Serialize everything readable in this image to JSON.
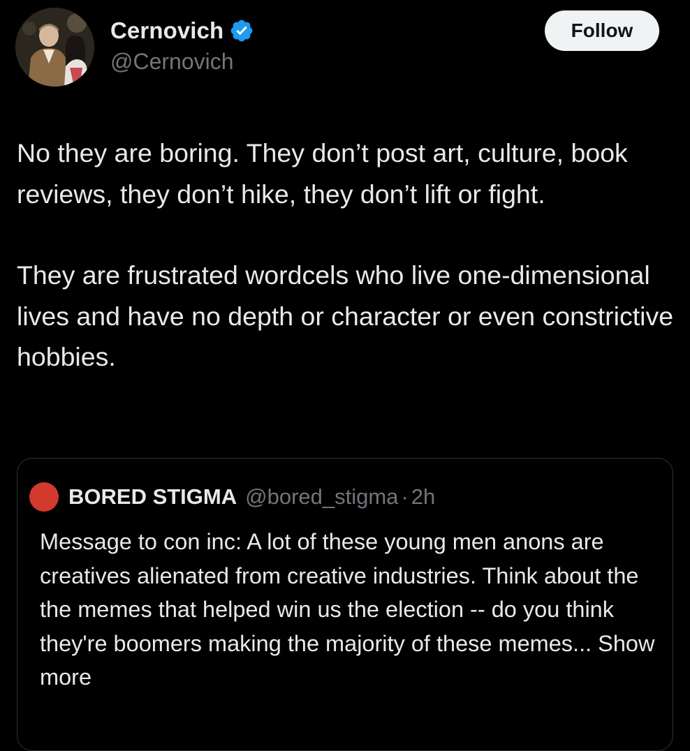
{
  "tweet": {
    "author": {
      "display_name": "Cernovich",
      "handle": "@Cernovich",
      "verified_icon": "verified-badge-icon",
      "verified_color": "#1d9bf0"
    },
    "follow_label": "Follow",
    "paragraphs": [
      "No they are boring. They don’t post art, culture, book reviews, they don’t hike, they don’t lift or fight.",
      "They are frustrated wordcels who live one-dimensional lives and have no depth or character or even constrictive hobbies."
    ]
  },
  "quote": {
    "display_name": "BORED STIGMA",
    "handle": "@bored_stigma",
    "separator": "·",
    "time": "2h",
    "avatar_color": "#d23a2e",
    "text": "Message to con inc: A lot of these young men anons are creatives alienated from creative industries. Think about the the memes that helped win us the election -- do you think they're boomers making the majority of these memes...",
    "show_more_label": "Show more"
  }
}
